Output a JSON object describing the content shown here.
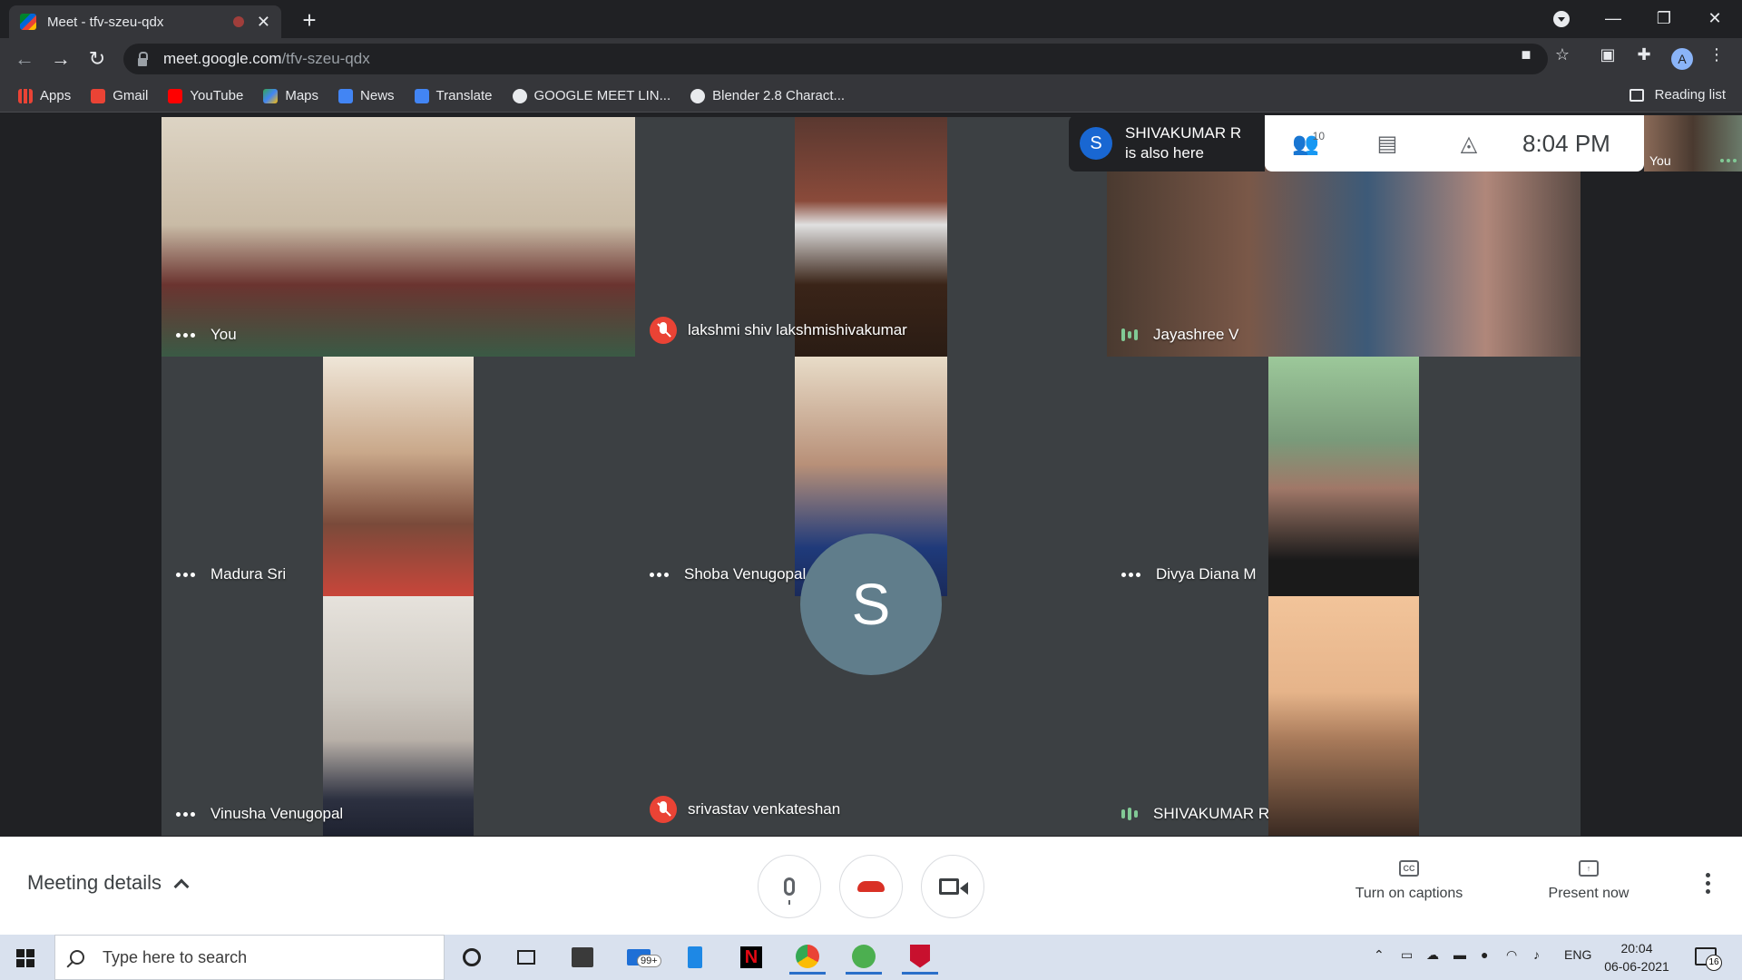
{
  "browser": {
    "tab_title": "Meet - tfv-szeu-qdx",
    "url_host": "meet.google.com",
    "url_path": "/tfv-szeu-qdx",
    "profile_initial": "A",
    "bookmarks": [
      {
        "label": "Apps",
        "icon": "apps-grid-icon",
        "color": "#ea4335"
      },
      {
        "label": "Gmail",
        "icon": "gmail-icon",
        "color": "#ea4335"
      },
      {
        "label": "YouTube",
        "icon": "youtube-icon",
        "color": "#ff0000"
      },
      {
        "label": "Maps",
        "icon": "maps-icon",
        "color": "#34a853"
      },
      {
        "label": "News",
        "icon": "news-icon",
        "color": "#4285f4"
      },
      {
        "label": "Translate",
        "icon": "translate-icon",
        "color": "#4285f4"
      },
      {
        "label": "GOOGLE MEET LIN...",
        "icon": "globe-icon",
        "color": "#e8eaed"
      },
      {
        "label": "Blender 2.8 Charact...",
        "icon": "wordpress-icon",
        "color": "#e8eaed"
      }
    ],
    "reading_list": "Reading list"
  },
  "meet": {
    "participants": [
      {
        "name": "You",
        "status": "dots"
      },
      {
        "name": "lakshmi shiv lakshmishivakumar",
        "status": "muted"
      },
      {
        "name": "Jayashree V",
        "status": "speaking"
      },
      {
        "name": "Madura Sri",
        "status": "dots"
      },
      {
        "name": "Shoba Venugopal",
        "status": "dots"
      },
      {
        "name": "Divya Diana M",
        "status": "dots"
      },
      {
        "name": "Vinusha Venugopal",
        "status": "dots"
      },
      {
        "name": "srivastav venkateshan",
        "status": "muted"
      },
      {
        "name": "SHIVAKUMAR R",
        "status": "speaking"
      }
    ],
    "avatar_initial": "S",
    "notification": {
      "avatar": "S",
      "line1": "SHIVAKUMAR R",
      "line2": "is also here"
    },
    "people_count": "10",
    "time": "8:04 PM",
    "self_label": "You",
    "meeting_details": "Meeting details",
    "captions_label": "Turn on captions",
    "present_label": "Present now",
    "cc_icon_text": "CC"
  },
  "taskbar": {
    "search_placeholder": "Type here to search",
    "mail_badge": "99+",
    "language": "ENG",
    "time": "20:04",
    "date": "06-06-2021",
    "notifications": "16"
  }
}
